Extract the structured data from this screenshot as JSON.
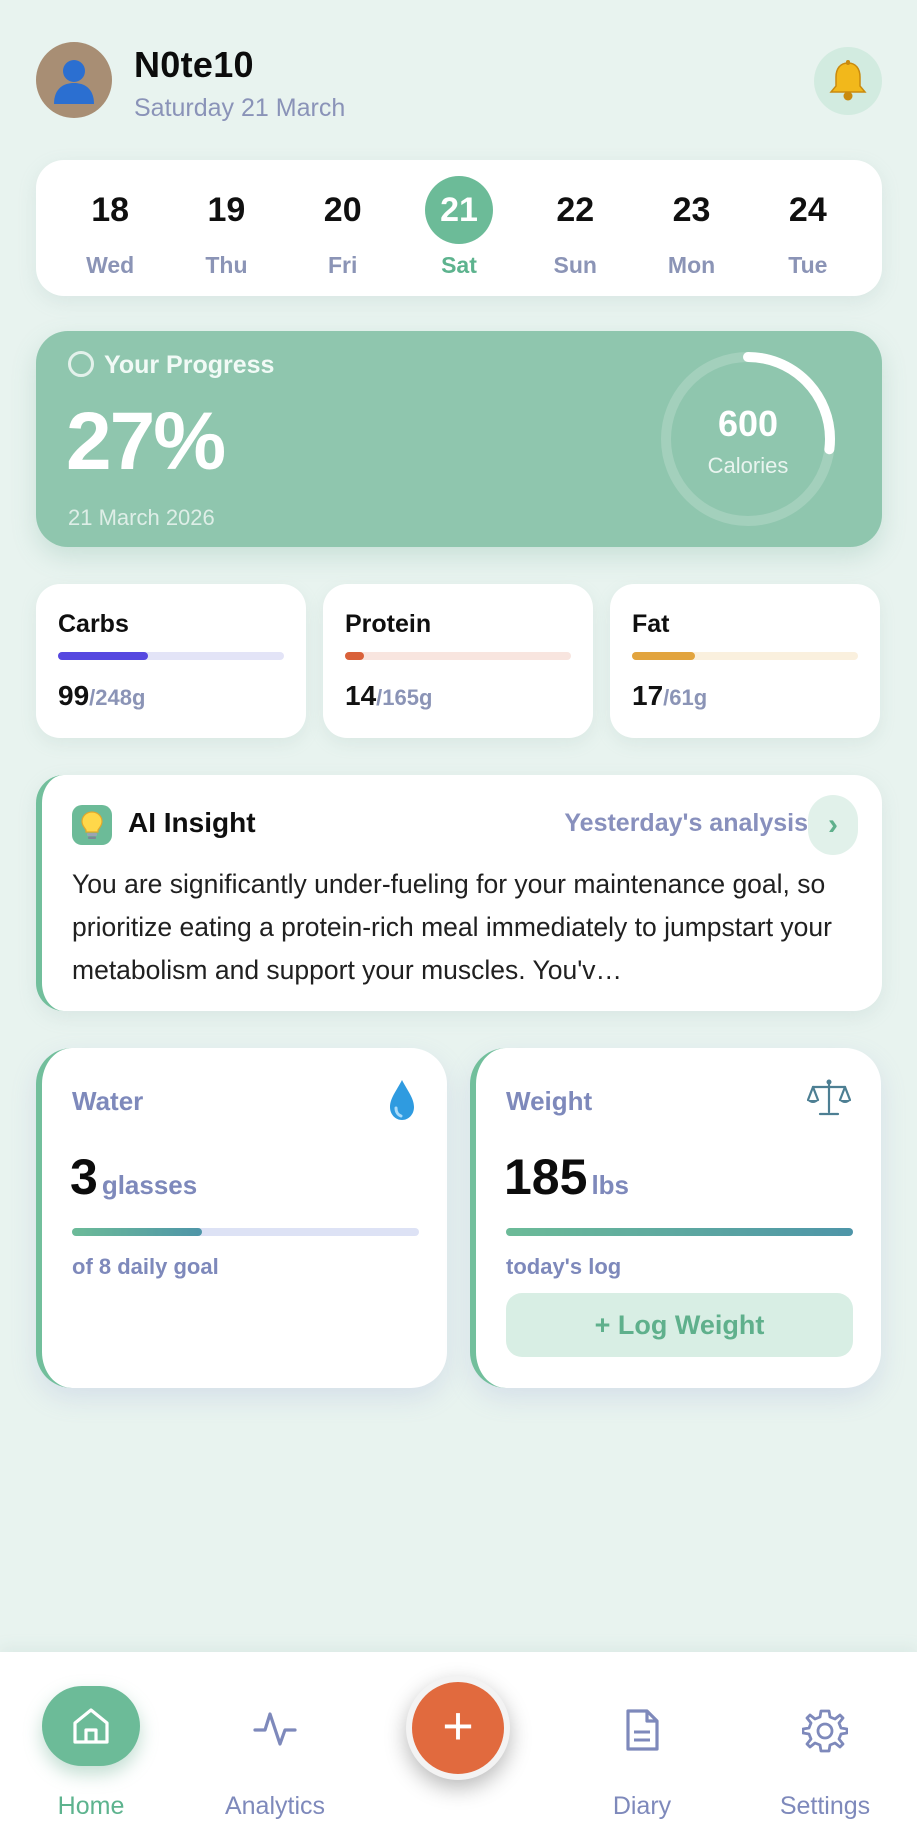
{
  "header": {
    "user_name": "N0te10",
    "date": "Saturday 21 March",
    "avatar_icon": "user-icon",
    "notification_icon": "bell-icon"
  },
  "week": {
    "days": [
      {
        "num": "18",
        "name": "Wed",
        "active": false
      },
      {
        "num": "19",
        "name": "Thu",
        "active": false
      },
      {
        "num": "20",
        "name": "Fri",
        "active": false
      },
      {
        "num": "21",
        "name": "Sat",
        "active": true
      },
      {
        "num": "22",
        "name": "Sun",
        "active": false
      },
      {
        "num": "23",
        "name": "Mon",
        "active": false
      },
      {
        "num": "24",
        "name": "Tue",
        "active": false
      }
    ]
  },
  "progress": {
    "label": "Your Progress",
    "percent": "27%",
    "date": "21 March 2026",
    "calories_value": "600",
    "calories_label": "Calories",
    "ring_fraction": 0.27
  },
  "macros": [
    {
      "title": "Carbs",
      "value": "99",
      "goal": "/248g",
      "fraction": 0.4,
      "color": "#5648e0",
      "track": "#e3e4f7"
    },
    {
      "title": "Protein",
      "value": "14",
      "goal": "/165g",
      "fraction": 0.085,
      "color": "#d9613a",
      "track": "#f8e5df"
    },
    {
      "title": "Fat",
      "value": "17",
      "goal": "/61g",
      "fraction": 0.28,
      "color": "#e2a43e",
      "track": "#faf0de"
    }
  ],
  "insight": {
    "title": "AI Insight",
    "link": "Yesterday's analysis",
    "chevron": "›",
    "icon": "lightbulb-icon",
    "body": "You are significantly under-fueling for your maintenance goal, so prioritize eating a protein-rich meal immediately to jumpstart your metabolism and support your muscles. You'v…"
  },
  "water": {
    "title": "Water",
    "value": "3",
    "unit": "glasses",
    "fraction": 0.375,
    "sub": "of 8 daily goal",
    "icon": "water-drop-icon"
  },
  "weight": {
    "title": "Weight",
    "value": "185",
    "unit": "lbs",
    "fraction": 1.0,
    "sub": "today's log",
    "button": "+ Log Weight",
    "icon": "scale-icon"
  },
  "nav": {
    "home": "Home",
    "analytics": "Analytics",
    "add": "+",
    "diary": "Diary",
    "settings": "Settings"
  },
  "colors": {
    "accent": "#6cbb98",
    "background": "#e8f3ef",
    "fab": "#e16a3e"
  }
}
